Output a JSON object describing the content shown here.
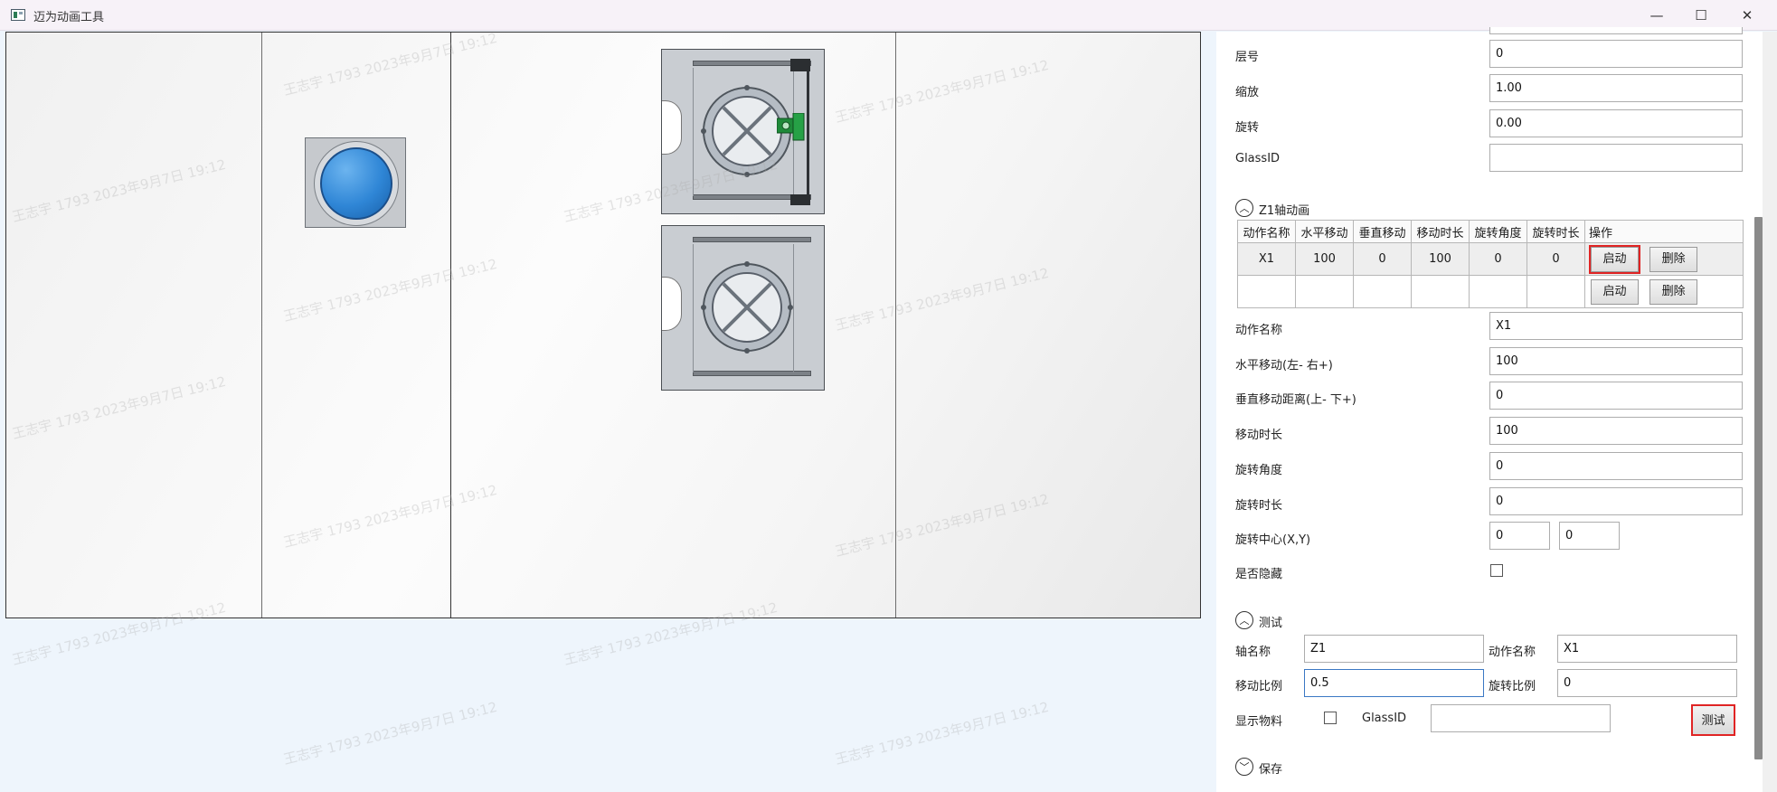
{
  "window": {
    "title": "迈为动画工具",
    "minimize": "—",
    "maximize": "☐",
    "close": "✕"
  },
  "watermark": "王志宇 1793 2023年9月7日 19:12",
  "props": {
    "layer_label": "层号",
    "layer_value": "0",
    "scale_label": "缩放",
    "scale_value": "1.00",
    "rotate_label": "旋转",
    "rotate_value": "0.00",
    "glassid_label": "GlassID",
    "glassid_value": ""
  },
  "animation": {
    "section_title": "Z1轴动画",
    "columns": [
      "动作名称",
      "水平移动",
      "垂直移动",
      "移动时长",
      "旋转角度",
      "旋转时长",
      "操作"
    ],
    "rows": [
      {
        "name": "X1",
        "h": "100",
        "v": "0",
        "dur": "100",
        "angle": "0",
        "rdur": "0",
        "start": "启动",
        "delete": "删除"
      },
      {
        "name": "",
        "h": "",
        "v": "",
        "dur": "",
        "angle": "",
        "rdur": "",
        "start": "启动",
        "delete": "删除"
      }
    ]
  },
  "detail": {
    "name_label": "动作名称",
    "name_value": "X1",
    "h_label": "水平移动(左- 右+)",
    "h_value": "100",
    "v_label": "垂直移动距离(上- 下+)",
    "v_value": "0",
    "dur_label": "移动时长",
    "dur_value": "100",
    "angle_label": "旋转角度",
    "angle_value": "0",
    "rdur_label": "旋转时长",
    "rdur_value": "0",
    "center_label": "旋转中心(X,Y)",
    "center_x": "0",
    "center_y": "0",
    "hidden_label": "是否隐藏",
    "hidden_checked": false
  },
  "test": {
    "section_title": "测试",
    "axis_label": "轴名称",
    "axis_value": "Z1",
    "action_label": "动作名称",
    "action_value": "X1",
    "move_ratio_label": "移动比例",
    "move_ratio_value": "0.5",
    "rotate_ratio_label": "旋转比例",
    "rotate_ratio_value": "0",
    "show_material_label": "显示物料",
    "show_material_checked": false,
    "glassid_label": "GlassID",
    "glassid_value": "",
    "test_button": "测试"
  },
  "save": {
    "section_title": "保存"
  }
}
